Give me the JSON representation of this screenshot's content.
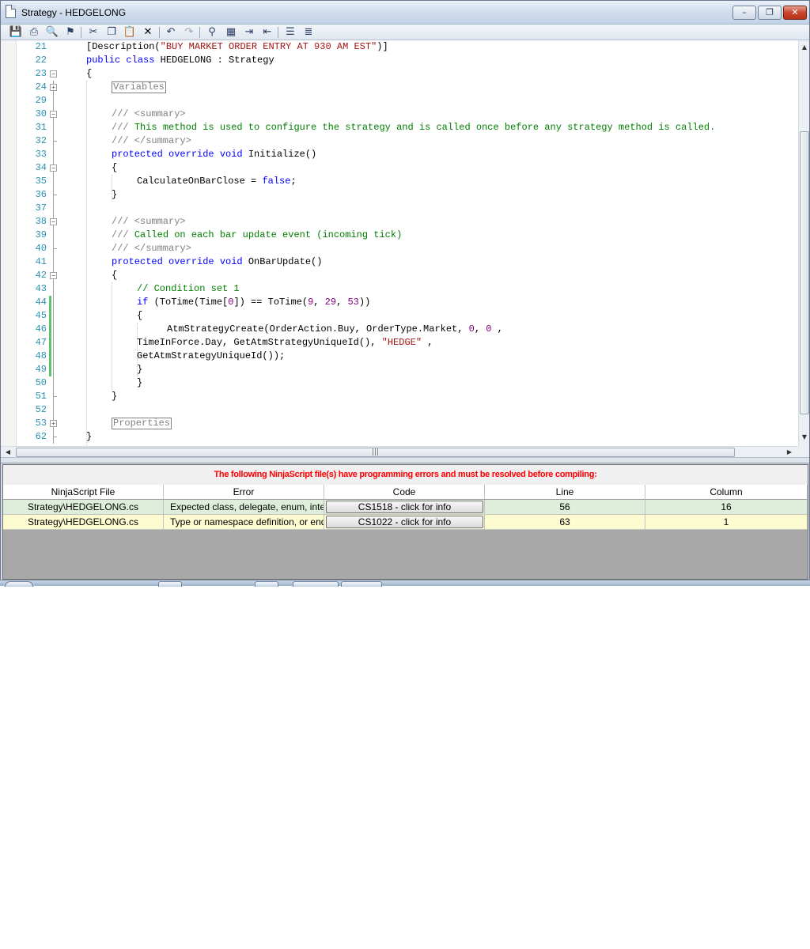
{
  "window": {
    "title": "Strategy - HEDGELONG",
    "minimize": "–",
    "maximize": "❐",
    "close": "✕"
  },
  "toolbar": {
    "buttons": [
      "save",
      "print",
      "print-preview",
      "compile",
      "cut",
      "copy",
      "paste",
      "delete",
      "undo",
      "redo",
      "find",
      "replace",
      "indent",
      "outdent",
      "comment",
      "uncomment"
    ]
  },
  "editor": {
    "lines": [
      {
        "n": "21",
        "text": "[Description(\"BUY MARKET ORDER ENTRY AT 930 AM EST\")]"
      },
      {
        "n": "22",
        "text": "public class HEDGELONG : Strategy"
      },
      {
        "n": "23",
        "text": "{"
      },
      {
        "n": "24",
        "text": "Variables"
      },
      {
        "n": "29",
        "text": ""
      },
      {
        "n": "30",
        "text": "/// <summary>"
      },
      {
        "n": "31",
        "text": "/// This method is used to configure the strategy and is called once before any strategy method is called."
      },
      {
        "n": "32",
        "text": "/// </summary>"
      },
      {
        "n": "33",
        "text": "protected override void Initialize()"
      },
      {
        "n": "34",
        "text": "{"
      },
      {
        "n": "35",
        "text": "CalculateOnBarClose = false;"
      },
      {
        "n": "36",
        "text": "}"
      },
      {
        "n": "37",
        "text": ""
      },
      {
        "n": "38",
        "text": "/// <summary>"
      },
      {
        "n": "39",
        "text": "/// Called on each bar update event (incoming tick)"
      },
      {
        "n": "40",
        "text": "/// </summary>"
      },
      {
        "n": "41",
        "text": "protected override void OnBarUpdate()"
      },
      {
        "n": "42",
        "text": "{"
      },
      {
        "n": "43",
        "text": "// Condition set 1"
      },
      {
        "n": "44",
        "text": "if (ToTime(Time[0]) == ToTime(9, 29, 53))"
      },
      {
        "n": "45",
        "text": "{"
      },
      {
        "n": "46",
        "text": "AtmStrategyCreate(OrderAction.Buy, OrderType.Market, 0, 0 ,"
      },
      {
        "n": "47",
        "text": "TimeInForce.Day, GetAtmStrategyUniqueId(), \"HEDGE\" ,"
      },
      {
        "n": "48",
        "text": "GetAtmStrategyUniqueId());"
      },
      {
        "n": "49",
        "text": "}"
      },
      {
        "n": "50",
        "text": "}"
      },
      {
        "n": "51",
        "text": "}"
      },
      {
        "n": "52",
        "text": ""
      },
      {
        "n": "53",
        "text": "Properties"
      },
      {
        "n": "62",
        "text": "}"
      }
    ],
    "hscroll_grip": "|||"
  },
  "errors": {
    "heading": "The following NinjaScript file(s) have programming errors and must be resolved before compiling:",
    "columns": [
      "NinjaScript File",
      "Error",
      "Code",
      "Line",
      "Column"
    ],
    "rows": [
      {
        "file": "Strategy\\HEDGELONG.cs",
        "error": "Expected class, delegate, enum, interf",
        "code": "CS1518 - click for info",
        "line": "56",
        "column": "16"
      },
      {
        "file": "Strategy\\HEDGELONG.cs",
        "error": "Type or namespace definition, or end-",
        "code": "CS1022 - click for info",
        "line": "63",
        "column": "1"
      }
    ]
  },
  "colors": {
    "keyword": "#0000ff",
    "string": "#a31515",
    "comment": "#008000",
    "line_number": "#2b91af",
    "error_heading": "#ff0000",
    "row1_bg": "#dfeeda",
    "row2_bg": "#fdfbd0"
  }
}
